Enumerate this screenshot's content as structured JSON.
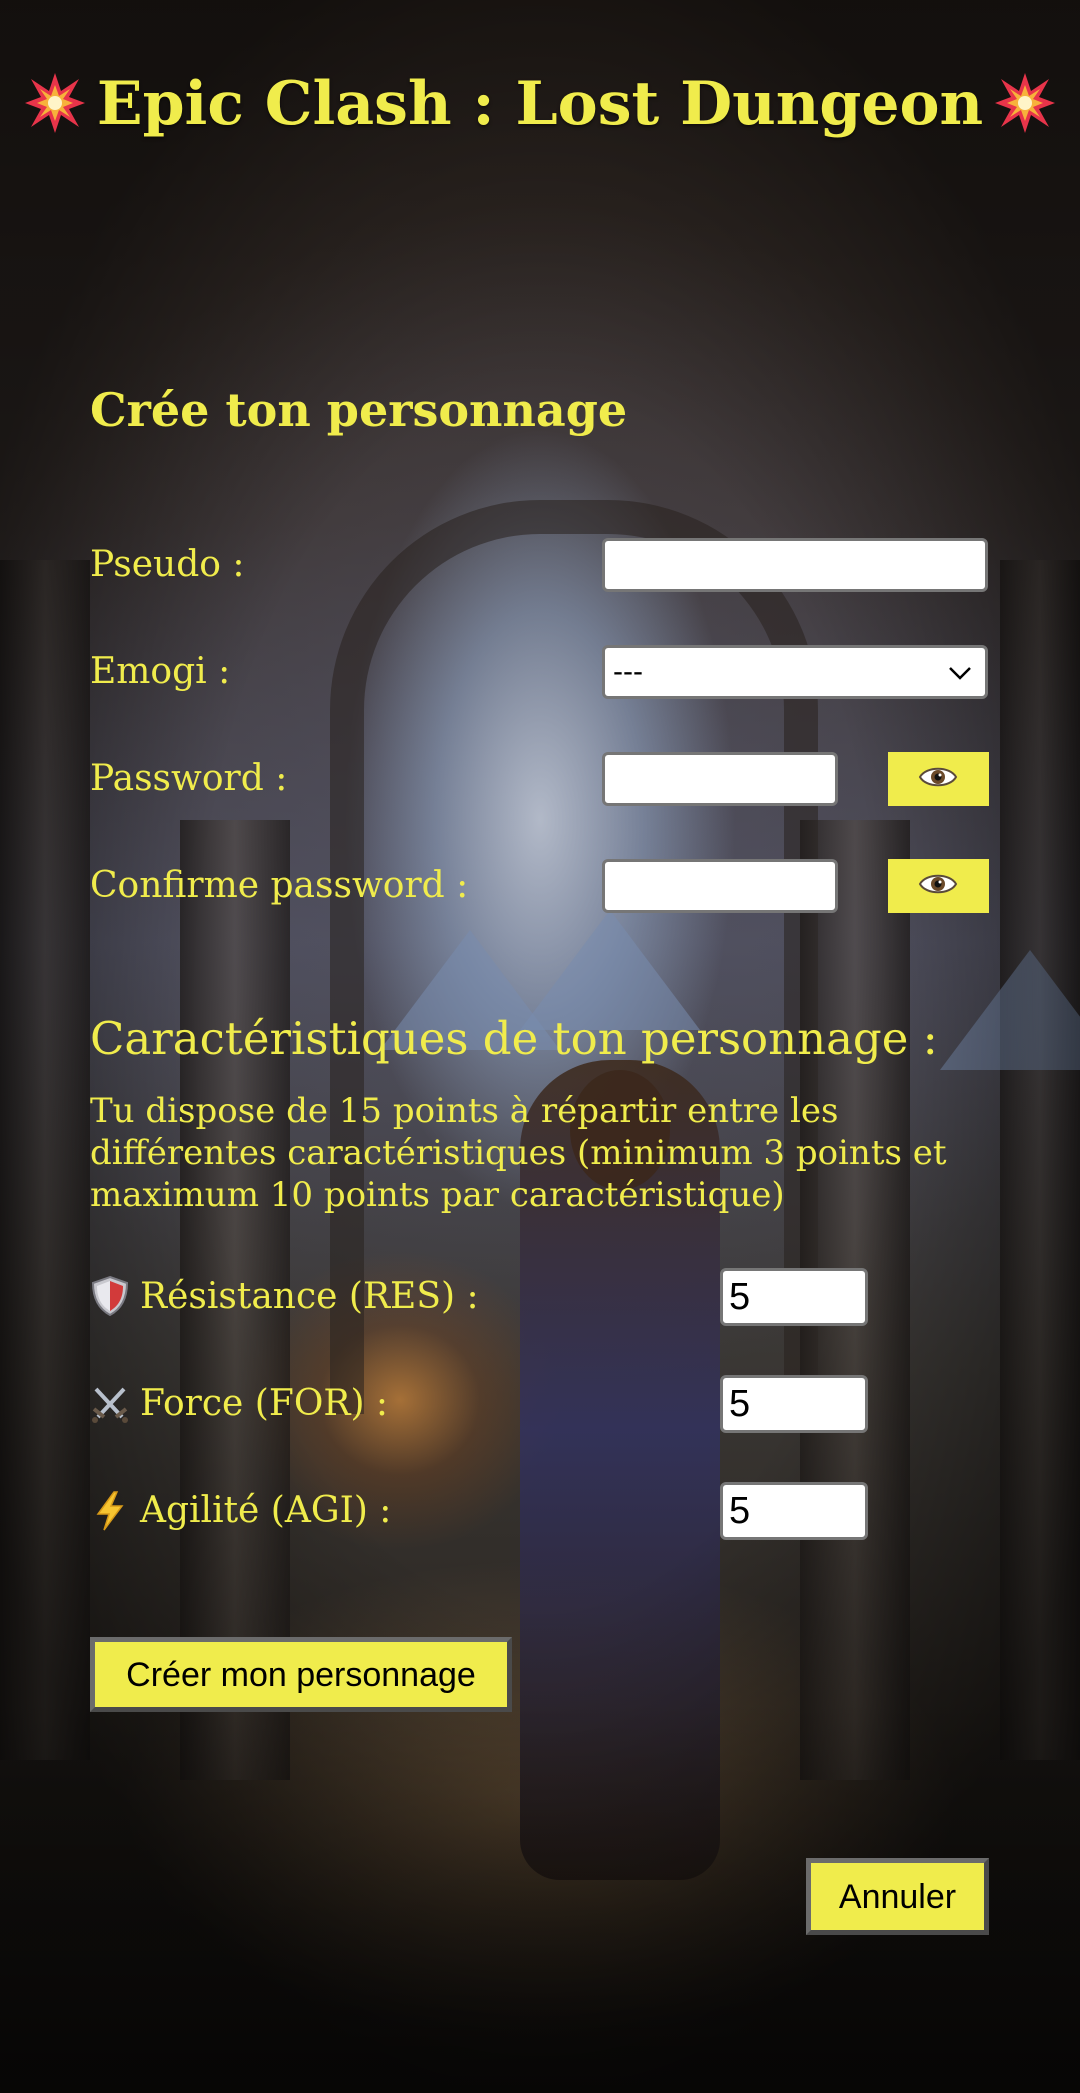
{
  "header": {
    "title": "Epic Clash : Lost Dungeon",
    "title_icon_left": "collision-burst-icon",
    "title_icon_right": "collision-burst-icon"
  },
  "form": {
    "section_title": "Crée ton personnage",
    "pseudo_label": "Pseudo :",
    "pseudo_value": "",
    "emoji_label": "Emogi :",
    "emoji_selected": "---",
    "password_label": "Password :",
    "password_value": "",
    "confirm_label": "Confirme password :",
    "confirm_value": "",
    "toggle_icon": "eye-icon"
  },
  "characteristics": {
    "title": "Caractéristiques de ton personnage :",
    "description": "Tu dispose de 15 points à répartir entre les différentes caractéristiques (minimum 3 points et maximum 10 points par caractéristique)",
    "stats": [
      {
        "label": "Résistance (RES) :",
        "icon": "shield-icon",
        "value": "5"
      },
      {
        "label": "Force (FOR) :",
        "icon": "crossed-swords-icon",
        "value": "5"
      },
      {
        "label": "Agilité (AGI) :",
        "icon": "lightning-icon",
        "value": "5"
      }
    ]
  },
  "actions": {
    "create_label": "Créer mon personnage",
    "cancel_label": "Annuler"
  },
  "colors": {
    "accent": "#f0ec4c",
    "button_border": "#6b6b6b",
    "input_border": "#767676"
  }
}
